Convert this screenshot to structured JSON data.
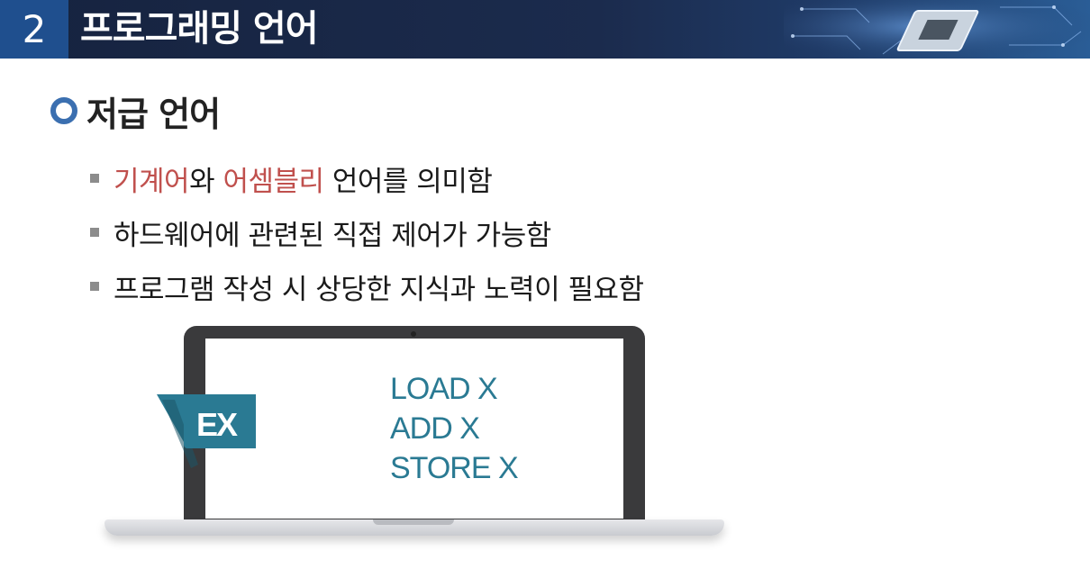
{
  "header": {
    "number": "2",
    "title": "프로그래밍 언어",
    "background": "#16233f",
    "number_box_color": "#1f4f8e"
  },
  "section": {
    "title": "저급 언어",
    "bullet_icon": "ring-bullet-icon",
    "bullet_color": "#3b6fb0"
  },
  "bullets": [
    {
      "parts": [
        {
          "text": "기계어",
          "accent": true
        },
        {
          "text": "와 ",
          "accent": false
        },
        {
          "text": "어셈블리",
          "accent": true
        },
        {
          "text": " 언어를 의미함",
          "accent": false
        }
      ]
    },
    {
      "text": "하드웨어에 관련된 직접 제어가 가능함"
    },
    {
      "text": "프로그램 작성 시 상당한 지식과 노력이 필요함"
    }
  ],
  "colors": {
    "accent": "#c0504d",
    "code": "#2a7a93",
    "tag": "#2a7a93"
  },
  "example": {
    "tag_label": "EX",
    "code_lines": [
      "LOAD X",
      "ADD X",
      "STORE X"
    ]
  }
}
